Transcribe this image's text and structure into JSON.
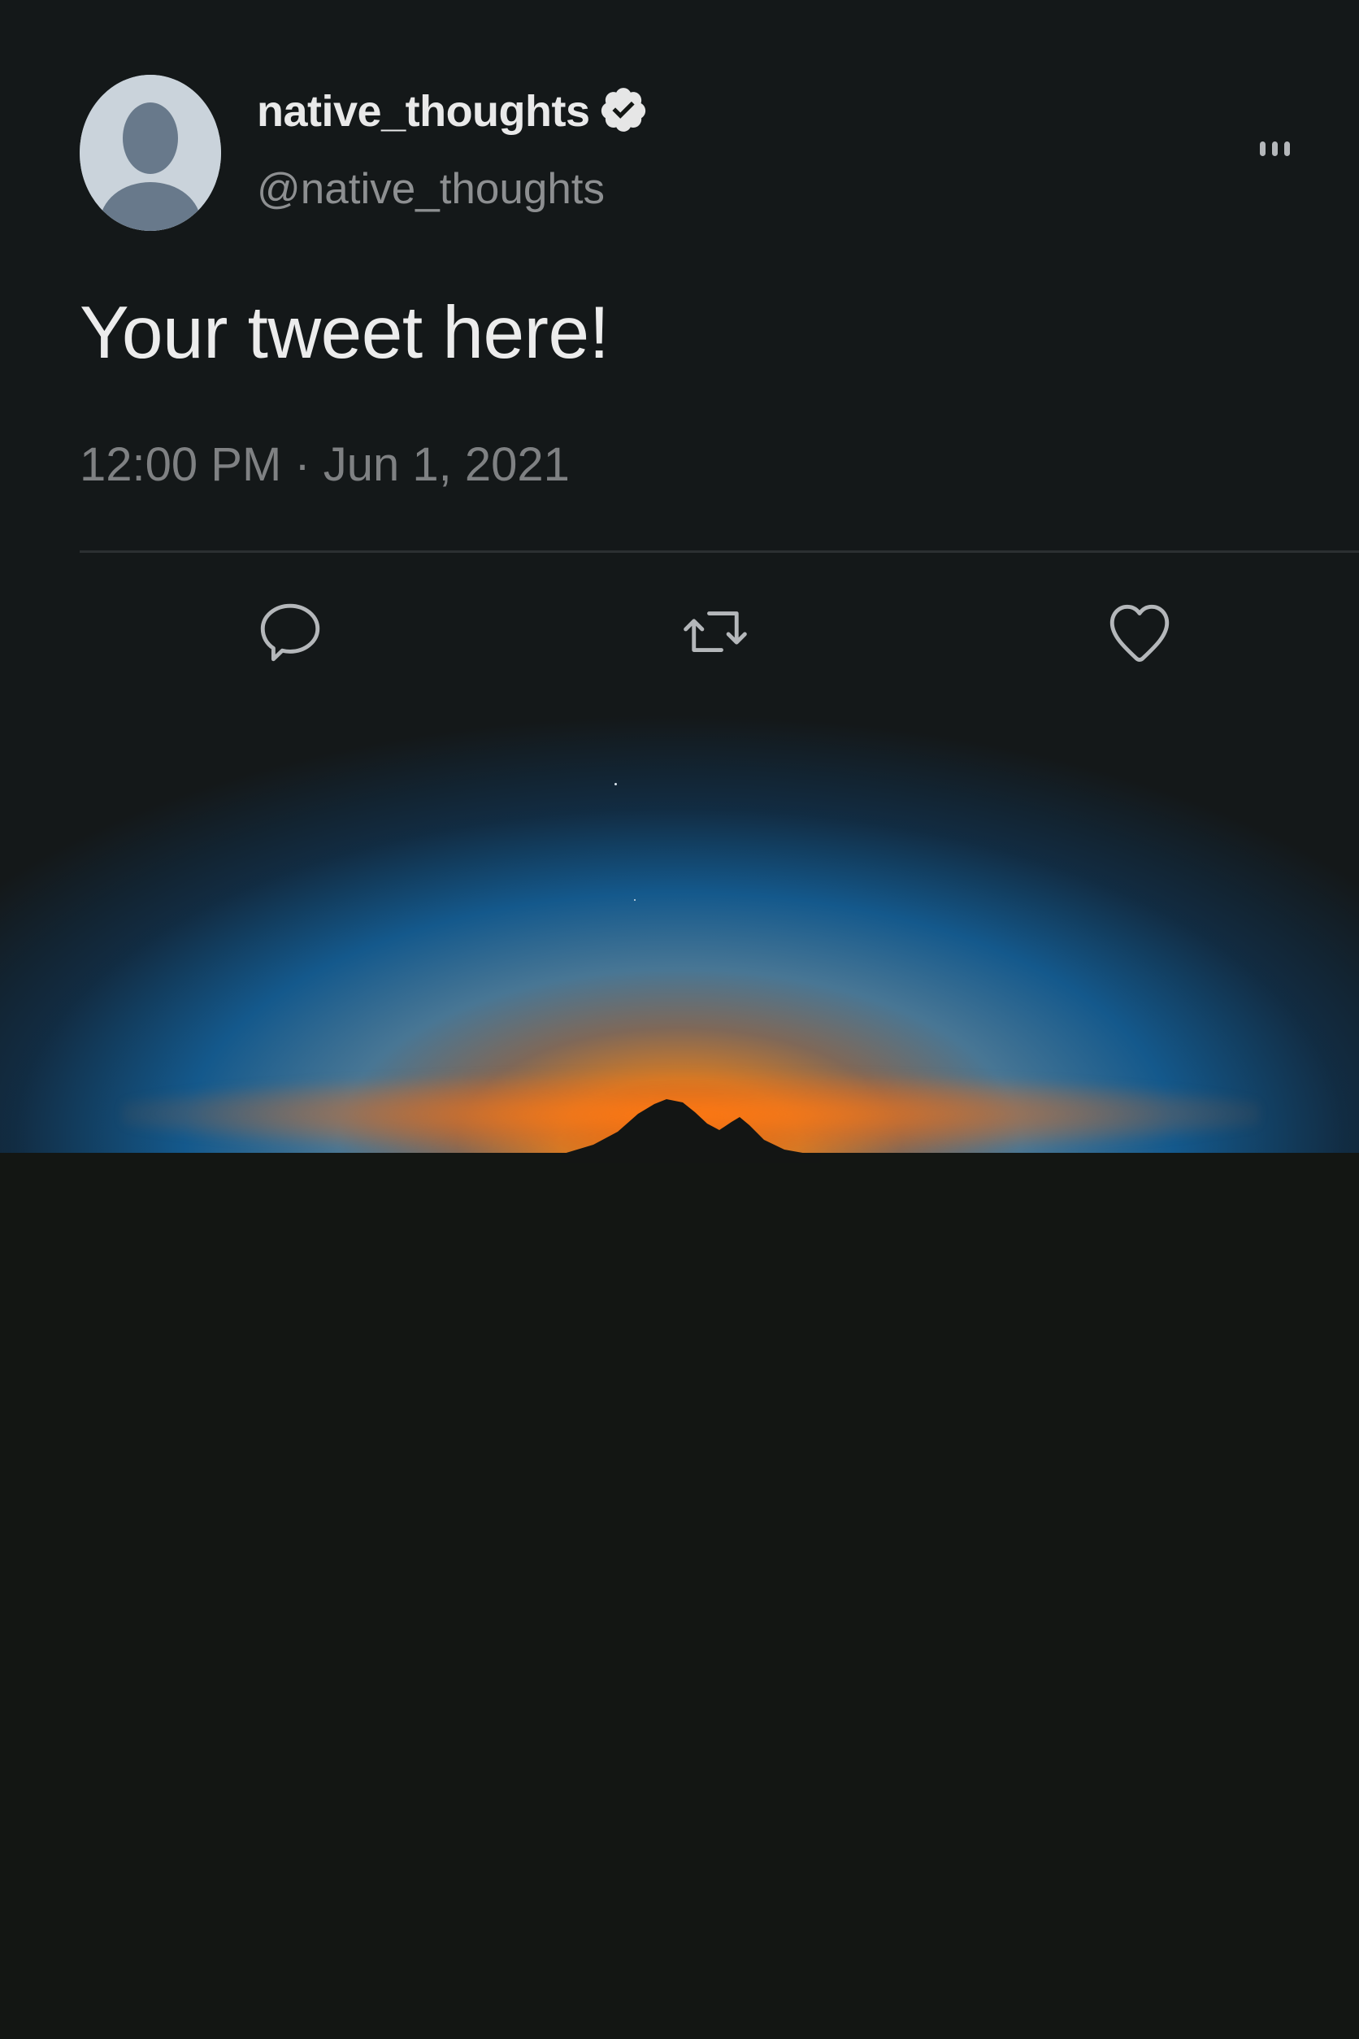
{
  "tweet": {
    "display_name": "native_thoughts",
    "handle": "@native_thoughts",
    "verified": true,
    "text": "Your tweet here!",
    "timestamp": "12:00 PM · Jun 1, 2021"
  },
  "icons": {
    "avatar": "default-avatar-icon",
    "verified": "verified-badge-icon",
    "more": "more-options-icon",
    "reply": "reply-bubble-icon",
    "retweet": "retweet-icon",
    "like": "heart-icon"
  },
  "colors": {
    "background": "#131613",
    "text_primary": "#ececec",
    "text_secondary": "#8d8f91",
    "icon": "#b4b7ba",
    "sunset_orange": "#ff6e00",
    "sky_blue": "#1464a0"
  }
}
